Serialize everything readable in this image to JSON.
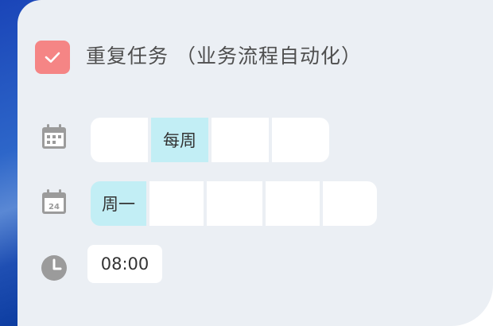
{
  "task": {
    "checked": true,
    "title": "重复任务 （业务流程自动化）",
    "checkbox_color": "#f58585"
  },
  "repeat_row": {
    "icon": "calendar-grid-icon",
    "options": [
      "",
      "每周",
      "",
      ""
    ],
    "selected_index": 1
  },
  "day_row": {
    "icon": "calendar-24-icon",
    "calendar_number": "24",
    "options": [
      "周一",
      "",
      "",
      "",
      ""
    ],
    "selected_index": 0
  },
  "time_row": {
    "icon": "clock-icon",
    "time": "08:00"
  },
  "colors": {
    "panel_bg": "#ebeff4",
    "selected_segment": "#c2eef5",
    "icon_gray": "#9b9b9b"
  }
}
